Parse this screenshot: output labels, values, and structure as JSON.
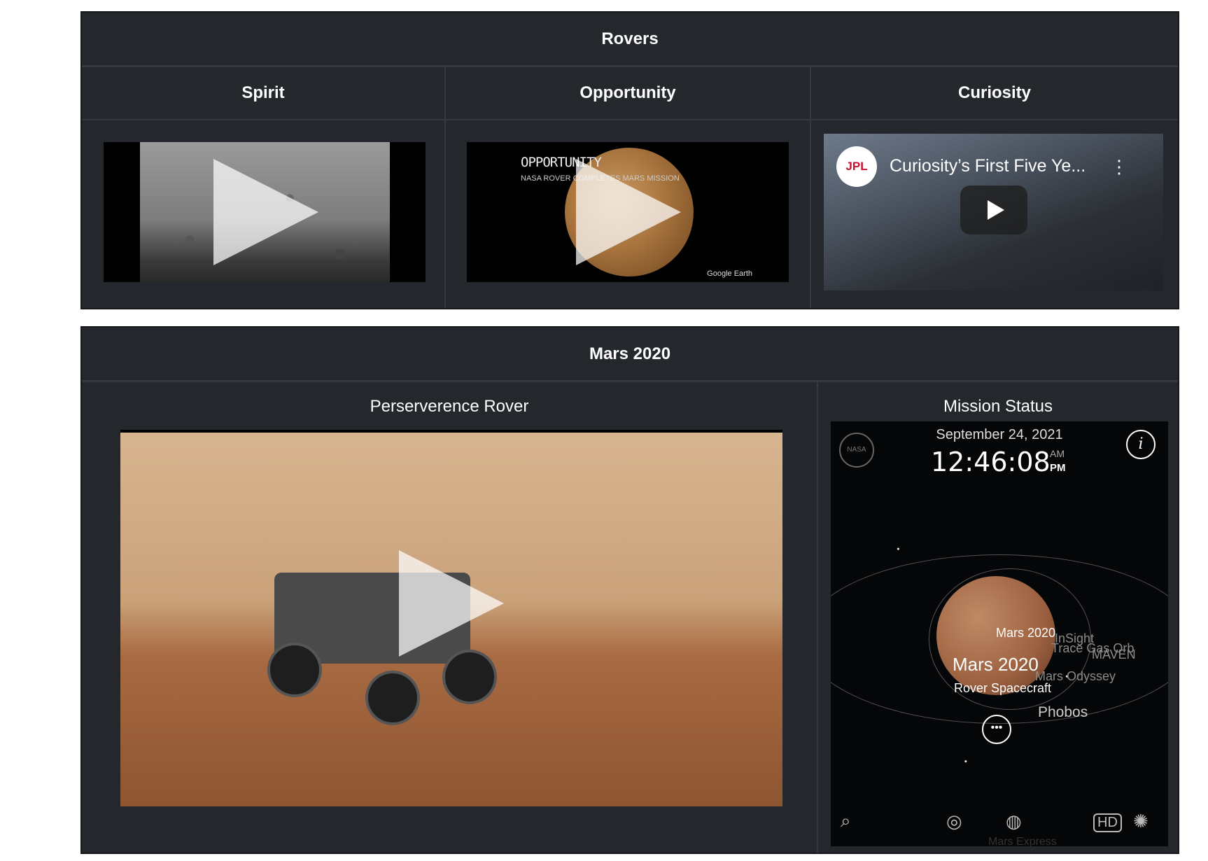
{
  "rovers": {
    "title": "Rovers",
    "spirit": {
      "name": "Spirit"
    },
    "opportunity": {
      "name": "Opportunity",
      "video_title": "OPPORTUNITY",
      "video_subtitle": "NASA ROVER COMPLETES MARS MISSION",
      "video_credit": "Google Earth"
    },
    "curiosity": {
      "name": "Curiosity",
      "logo_text": "JPL",
      "video_title": "Curiosity’s First Five Ye...",
      "menu_glyph": "⋮"
    }
  },
  "mars2020": {
    "title": "Mars 2020",
    "perseverance": {
      "heading": "Perserverence Rover"
    },
    "status": {
      "heading": "Mission Status",
      "date": "September 24, 2021",
      "time": "12:46:08",
      "am": "AM",
      "pm": "PM",
      "info_glyph": "i",
      "nasa_text": "NASA",
      "label_primary": "Mars 2020",
      "label_big": "Mars 2020",
      "label_rover": "Rover Spacecraft",
      "label_insight": "InSight",
      "label_tgo": "Trace Gas Orb",
      "label_maven": "MAVEN",
      "label_odyssey": "Mars Odyssey",
      "label_phobos": "Phobos",
      "label_express": "Mars Express",
      "more_glyph": "•••",
      "hd_label": "HD"
    }
  },
  "colors": {
    "panel_bg": "#24272c",
    "panel_border": "#161718",
    "text": "#ffffff"
  }
}
